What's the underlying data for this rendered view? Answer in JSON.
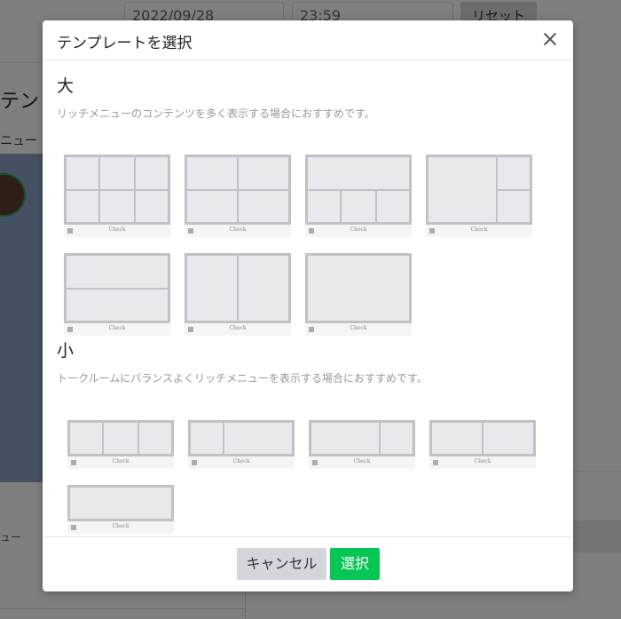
{
  "background": {
    "date_value": "2022/09/28",
    "time_value": "23:59",
    "reset_label": "リセット",
    "page_title_fragment": "テン",
    "menu_label_fragment": "ニュー",
    "help_icon": "?",
    "bottom_text_fragment": "ュー"
  },
  "modal": {
    "title": "テンプレートを選択",
    "close_icon": "close-icon",
    "large": {
      "title": "大",
      "description": "リッチメニューのコンテンツを多く表示する場合におすすめです。"
    },
    "small": {
      "title": "小",
      "description": "トークルームにバランスよくリッチメニューを表示する場合におすすめです。"
    },
    "template_label": "Check",
    "footer": {
      "cancel_label": "キャンセル",
      "select_label": "選択"
    }
  },
  "colors": {
    "primary_green": "#06c755",
    "cancel_gray": "#d3d6db"
  }
}
